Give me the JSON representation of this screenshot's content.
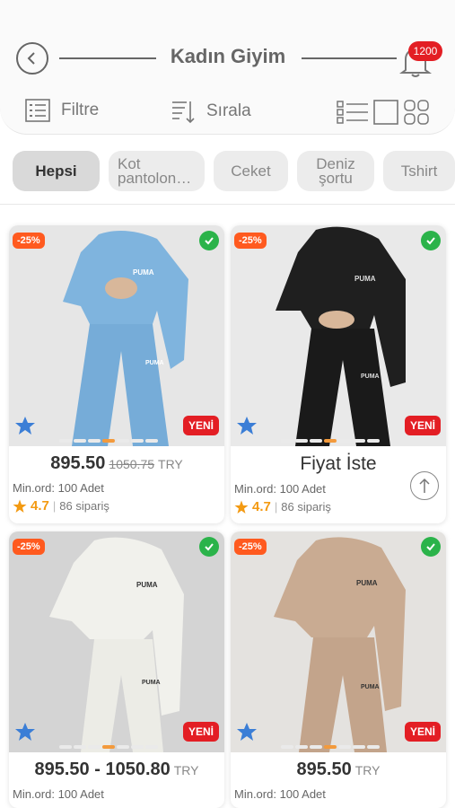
{
  "header": {
    "title": "Kadın Giyim",
    "notification_count": "1200",
    "filter_label": "Filtre",
    "sort_label": "Sırala"
  },
  "chips": [
    {
      "label": "Hepsi",
      "active": true
    },
    {
      "label": "Kot pantolon…",
      "active": false
    },
    {
      "label": "Ceket",
      "active": false
    },
    {
      "label": "Deniz şortu",
      "active": false
    },
    {
      "label": "Tshirt",
      "active": false
    }
  ],
  "products": [
    {
      "discount": "-25%",
      "badge": "YENİ",
      "price": "895.50",
      "old_price": "1050.75",
      "currency": "TRY",
      "min_order": "Min.ord: 100 Adet",
      "rating": "4.7",
      "orders": "86 sipariş",
      "color": "#7fb4de"
    },
    {
      "discount": "-25%",
      "badge": "YENİ",
      "price": "Fiyat İste",
      "old_price": "",
      "currency": "",
      "min_order": "Min.ord: 100 Adet",
      "rating": "4.7",
      "orders": "86 sipariş",
      "color": "#1f1f1f"
    },
    {
      "discount": "-25%",
      "badge": "YENİ",
      "price": "895.50 - 1050.80",
      "old_price": "",
      "currency": "TRY",
      "min_order": "Min.ord: 100 Adet",
      "rating": "",
      "orders": "",
      "color": "#eeeeea"
    },
    {
      "discount": "-25%",
      "badge": "YENİ",
      "price": "895.50",
      "old_price": "",
      "currency": "TRY",
      "min_order": "Min.ord: 100 Adet",
      "rating": "",
      "orders": "",
      "color": "#c9ab92"
    }
  ]
}
